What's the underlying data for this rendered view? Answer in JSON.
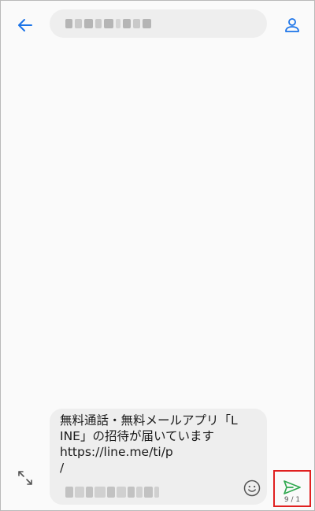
{
  "header": {
    "back_icon": "arrow-left-icon",
    "contact_icon": "person-icon",
    "recipient_display": "",
    "accent_color": "#1a73e8"
  },
  "composer": {
    "message": "無料通話・無料メールアプリ「LINE」の招待が届いています\nhttps://line.me/ti/p\n/",
    "expand_icon": "expand-icon",
    "emoji_icon": "smiley-icon"
  },
  "send": {
    "icon": "send-icon",
    "counter": "9 / 1",
    "highlight_color": "#e02020",
    "icon_color": "#2fa84f"
  }
}
